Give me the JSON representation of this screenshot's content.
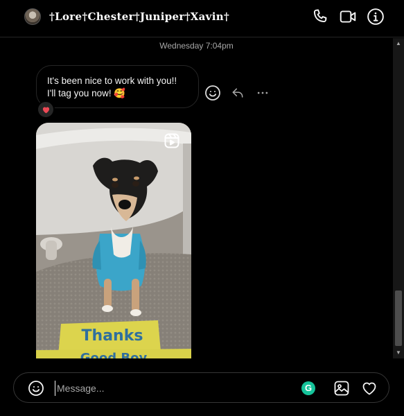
{
  "header": {
    "title": "†Lore†Chester†Juniper†Xavin†",
    "icons": [
      "phone-icon",
      "video-icon",
      "info-icon"
    ]
  },
  "thread": {
    "timestamp": "Wednesday 7:04pm",
    "message": {
      "line1": "It's been nice to work with you!!",
      "line2": "I'll tag you now! 🥰",
      "reaction": "heart-icon"
    },
    "message_actions": [
      "react-emoji-icon",
      "reply-icon",
      "more-icon"
    ],
    "shared_reel": {
      "icon": "reels-icon",
      "sign_text": "Thanks",
      "sign_text_2": "Good Boy"
    }
  },
  "composer": {
    "placeholder": "Message...",
    "icons": [
      "emoji-icon",
      "grammarly-icon",
      "image-icon",
      "heart-icon"
    ],
    "grammarly_letter": "G"
  },
  "colors": {
    "background": "#000000",
    "border": "#262626",
    "text": "#f5f5f5",
    "muted": "#a8a8a8",
    "reaction_heart": "#ed4956",
    "grammarly": "#15c39a"
  }
}
